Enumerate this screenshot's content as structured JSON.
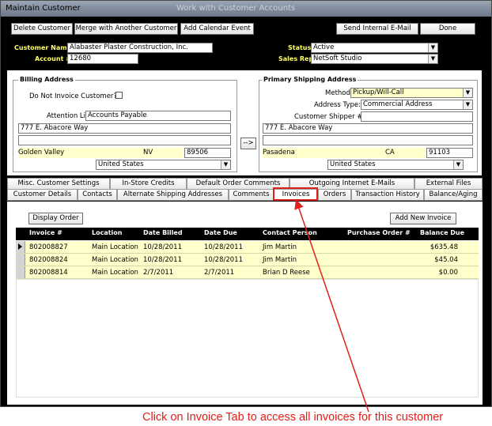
{
  "window": {
    "title": "Maintain Customer",
    "background_title": "Work with Customer Accounts"
  },
  "toolbar": {
    "delete_label": "Delete Customer",
    "merge_label": "Merge with Another Customer",
    "calendar_label": "Add Calendar Event",
    "email_label": "Send Internal E-Mail",
    "done_label": "Done"
  },
  "customer": {
    "name_label": "Customer Name:",
    "name_value": "Alabaster Plaster Construction, Inc.",
    "account_label": "Account #:",
    "account_value": "12680",
    "status_label": "Status:",
    "status_value": "Active",
    "salesrep_label": "Sales Rep:",
    "salesrep_value": "NetSoft Studio"
  },
  "billing": {
    "group_label": "Billing Address",
    "donot_invoice_label": "Do Not Invoice Customer?",
    "attention_label": "Attention Line:",
    "attention_value": "Accounts Payable",
    "address1": "777 E. Abacore Way",
    "address2": "",
    "city": "Golden Valley",
    "state": "NV",
    "zip": "89506",
    "country": "United States"
  },
  "copy_button_label": "-->",
  "shipping": {
    "group_label": "Primary Shipping Address",
    "method_label": "Method:",
    "method_value": "Pickup/Will-Call",
    "address_type_label": "Address Type:",
    "address_type_value": "Commercial Address",
    "shipper_label": "Customer Shipper #:",
    "shipper_value": "",
    "address1": "777 E. Abacore Way",
    "address2": "",
    "city": "Pasadena",
    "state": "CA",
    "zip": "91103",
    "country": "United States"
  },
  "tabs_row1": [
    "Misc. Customer Settings",
    "In-Store Credits",
    "Default Order Comments",
    "Outgoing Internet E-Mails",
    "External Files"
  ],
  "tabs_row2": [
    "Customer Details",
    "Contacts",
    "Alternate Shipping Addresses",
    "Comments",
    "Invoices",
    "Orders",
    "Transaction History",
    "Balance/Aging"
  ],
  "active_tab": "Invoices",
  "invoices": {
    "display_order_label": "Display Order",
    "add_new_label": "Add New Invoice",
    "columns": [
      "Invoice #",
      "Location",
      "Date Billed",
      "Date Due",
      "Contact Person",
      "Purchase Order #",
      "Balance Due"
    ],
    "rows": [
      {
        "invoice": "802008827",
        "location": "Main Location",
        "billed": "10/28/2011",
        "due": "10/28/2011",
        "contact": "Jim Martin",
        "po": "",
        "balance": "$635.48"
      },
      {
        "invoice": "802008824",
        "location": "Main Location",
        "billed": "10/28/2011",
        "due": "10/28/2011",
        "contact": "Jim Martin",
        "po": "",
        "balance": "$45.04"
      },
      {
        "invoice": "802008814",
        "location": "Main Location",
        "billed": "2/7/2011",
        "due": "2/7/2011",
        "contact": "Brian D Reese",
        "po": "",
        "balance": "$0.00"
      }
    ]
  },
  "annotation": "Click on Invoice Tab to access all invoices for this customer",
  "colors": {
    "label_yellow": "#ffff66",
    "field_yellow": "#ffffcc",
    "annotation_red": "#e0201c"
  }
}
